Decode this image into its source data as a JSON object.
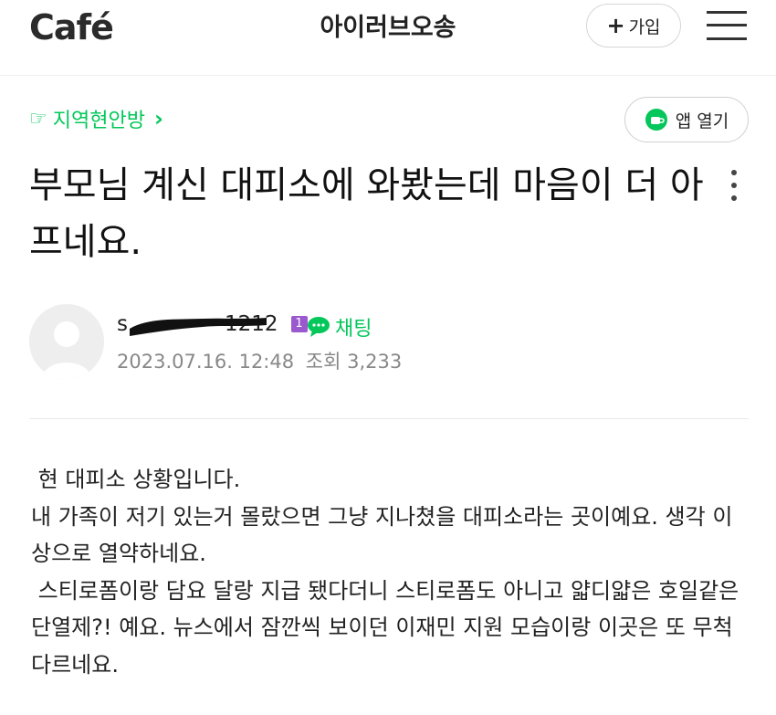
{
  "header": {
    "logo": "Café",
    "cafe_name": "아이러브오송",
    "join_plus": "+",
    "join_label": "가입",
    "menu_icon": "hamburger-menu-icon"
  },
  "board": {
    "hand": "☞",
    "name": "지역현안방",
    "chevron": "›"
  },
  "app_button": {
    "icon": "coffee-cup-icon",
    "label": "앱 열기"
  },
  "post": {
    "title": "부모님 계신 대피소에 와봤는데 마음이 더 아프네요.",
    "author_visible": "s",
    "author_suffix": "1212",
    "level": "1",
    "chat_label": "채팅",
    "date": "2023.07.16. 12:48",
    "views": "조회 3,233"
  },
  "body": {
    "lines": [
      " 현 대피소 상황입니다.",
      "내 가족이 저기 있는거 몰랐으면 그냥 지나쳤을 대피소라는 곳이예요. 생각 이상으로 열약하네요.",
      " 스티로폼이랑 담요 달랑 지급 됐다더니 스티로폼도 아니고 얇디얇은 호일같은 단열제?! 예요. 뉴스에서 잠깐씩 보이던 이재민 지원 모습이랑 이곳은 또 무척 다르네요."
    ]
  },
  "colors": {
    "brand_green": "#03c75a",
    "level_purple": "#9b59d0"
  }
}
